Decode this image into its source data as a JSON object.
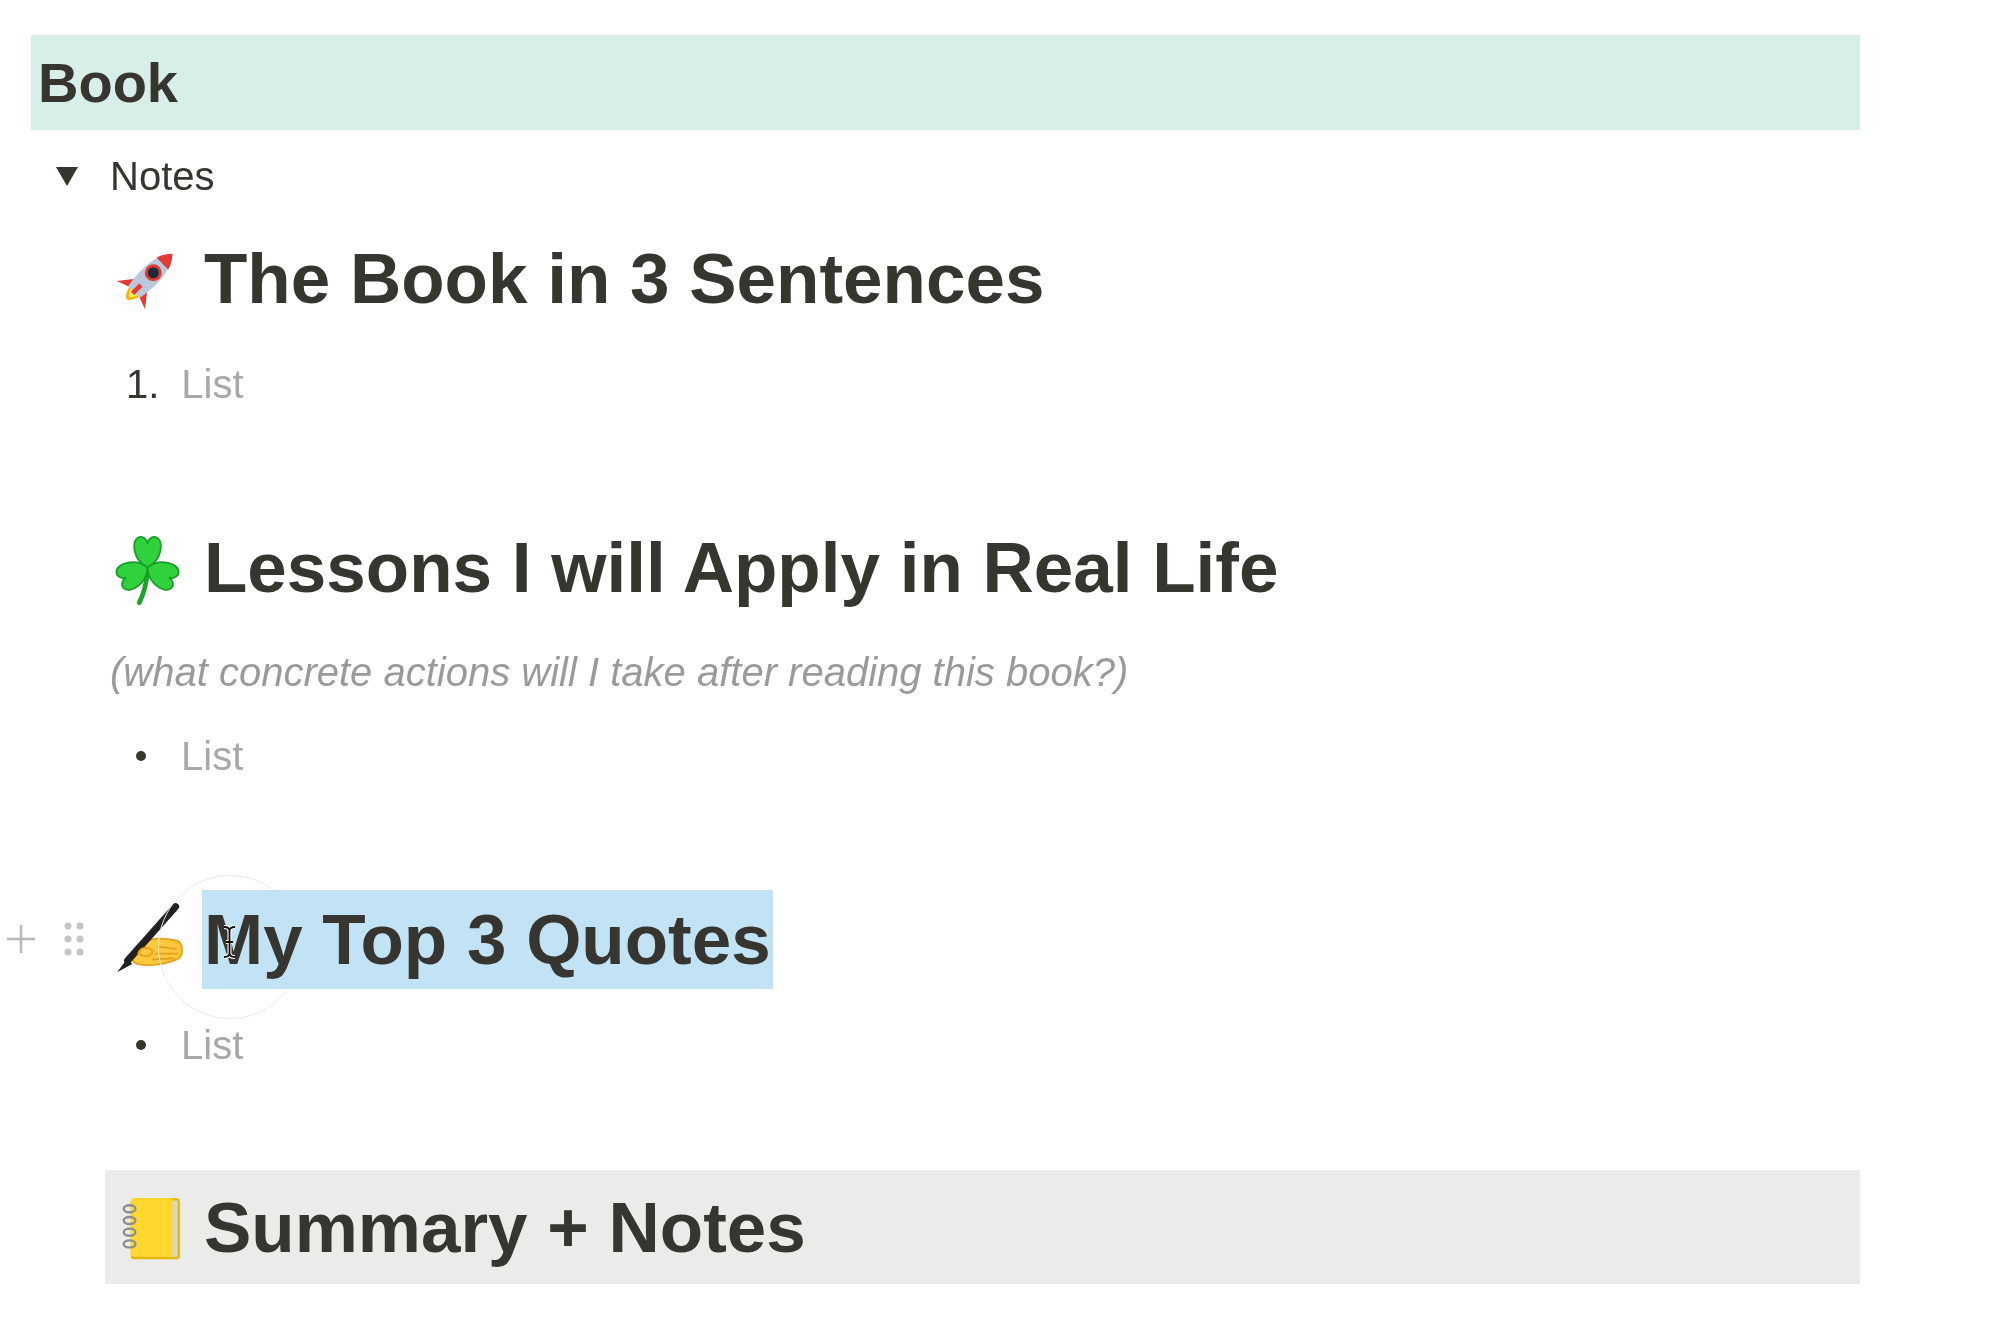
{
  "header": {
    "title": "Book"
  },
  "toggle": {
    "label": "Notes",
    "expanded": true,
    "children": [
      {
        "kind": "heading",
        "text": "The Book in 3 Sentences",
        "selected": false,
        "hovered": false,
        "shaded": false
      },
      {
        "kind": "numbered",
        "marker": "1.",
        "text": "List"
      },
      {
        "kind": "heading",
        "text": "Lessons I will Apply in Real Life",
        "selected": false,
        "hovered": false,
        "shaded": false
      },
      {
        "kind": "note",
        "text": "(what concrete actions will I take after reading this book?)"
      },
      {
        "kind": "bulleted",
        "text": "List"
      },
      {
        "kind": "heading",
        "text": "My Top 3 Quotes",
        "selected": true,
        "hovered": true,
        "shaded": false
      },
      {
        "kind": "bulleted",
        "text": "List"
      },
      {
        "kind": "heading",
        "text": "Summary + Notes",
        "selected": false,
        "hovered": false,
        "shaded": true
      }
    ]
  }
}
